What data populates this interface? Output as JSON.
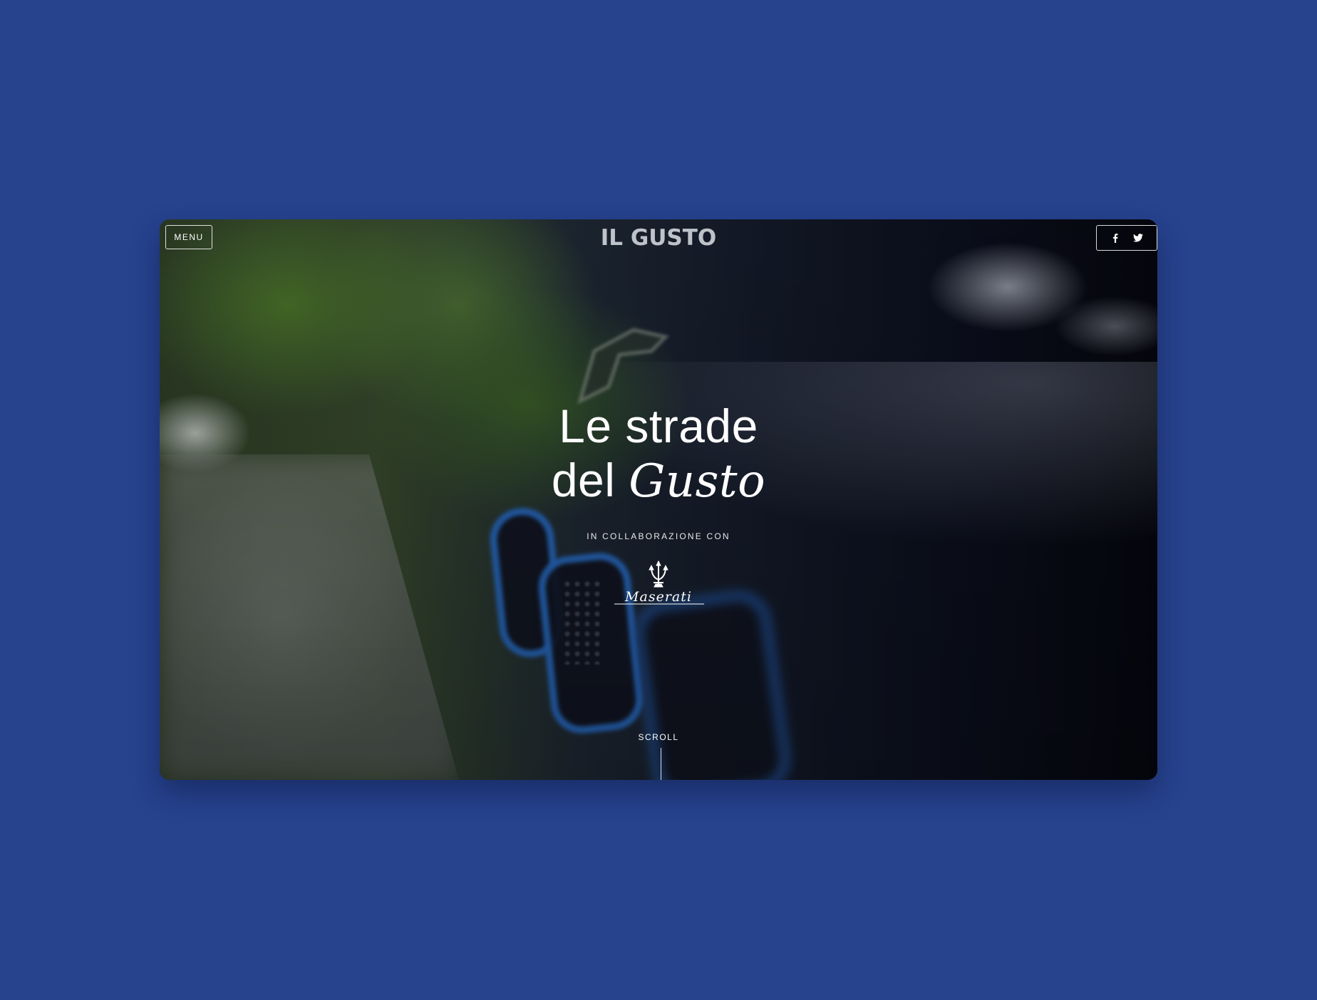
{
  "header": {
    "menu_label": "MENU",
    "logo_text": "IL GUSTO"
  },
  "social": {
    "icons": [
      "facebook-icon",
      "twitter-icon"
    ]
  },
  "hero": {
    "title_line1": "Le strade",
    "title_line2_prefix": "del ",
    "title_line2_italic": "Gusto",
    "collab_label": "IN COLLABORAZIONE CON",
    "partner_logo_text": "Maserati",
    "scroll_label": "SCROLL"
  },
  "colors": {
    "page_background": "#27438e",
    "text": "#ffffff"
  }
}
